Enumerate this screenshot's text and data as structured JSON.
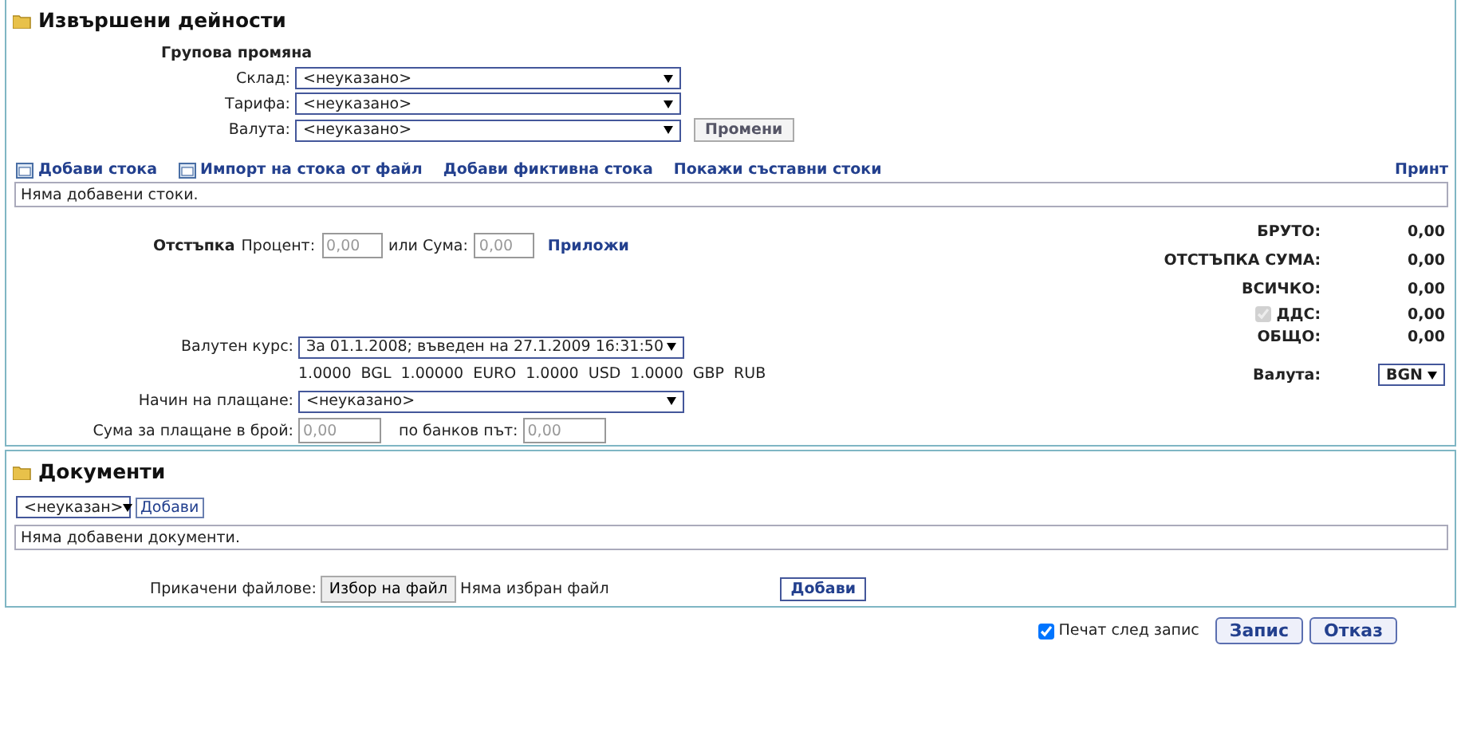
{
  "activities": {
    "title": "Извършени дейности",
    "group_change": {
      "title": "Групова промяна",
      "fields": [
        {
          "label": "Склад:",
          "value": "<неуказано>"
        },
        {
          "label": "Тарифа:",
          "value": "<неуказано>"
        },
        {
          "label": "Валута:",
          "value": "<неуказано>"
        }
      ],
      "apply_button": "Промени"
    },
    "links": [
      {
        "label": "Добави стока",
        "kind": "icon"
      },
      {
        "label": "Импорт на стока от файл",
        "kind": "icon"
      },
      {
        "label": "Добави фиктивна стока",
        "kind": "plain"
      },
      {
        "label": "Покажи съставни стоки",
        "kind": "plain"
      }
    ],
    "print_link": "Принт",
    "items_empty": "Няма добавени стоки.",
    "discount": {
      "title": "Отстъпка",
      "percent_label": "Процент:",
      "percent_placeholder": "0,00",
      "sum_label": "или Сума:",
      "sum_placeholder": "0,00",
      "apply_link": "Приложи"
    },
    "exchange": {
      "label": "Валутен курс:",
      "value": "За 01.1.2008; въведен на 27.1.2009 16:31:50",
      "rates": [
        "1.0000",
        "BGL",
        "1.00000",
        "EURO",
        "1.0000",
        "USD",
        "1.0000",
        "GBP",
        "RUB"
      ]
    },
    "payment": {
      "label": "Начин на плащане:",
      "value": "<неуказано>"
    },
    "cash": {
      "label": "Сума за плащане в брой:",
      "placeholder": "0,00"
    },
    "bank": {
      "label": "по банков път:",
      "placeholder": "0,00"
    },
    "totals": [
      {
        "label": "БРУТО:",
        "value": "0,00",
        "kind": "plain"
      },
      {
        "label": "ОТСТЪПКА СУМА:",
        "value": "0,00",
        "kind": "plain"
      },
      {
        "label": "ВСИЧКО:",
        "value": "0,00",
        "kind": "plain"
      },
      {
        "label": "ДДС:",
        "value": "0,00",
        "kind": "checkbox",
        "checked": true,
        "disabled": true
      },
      {
        "label": "ОБЩО:",
        "value": "0,00",
        "kind": "plain"
      }
    ],
    "currency": {
      "label": "Валута:",
      "value": "BGN"
    }
  },
  "documents": {
    "title": "Документи",
    "type_select": "<неуказан>",
    "add_button": "Добави",
    "empty": "Няма добавени документи.",
    "attach_label": "Прикачени файлове:",
    "file_button": "Избор на файл",
    "file_status": "Няма избран файл",
    "upload_button": "Добави"
  },
  "footer": {
    "print_after_save": {
      "label": "Печат след запис",
      "checked": true
    },
    "buttons": [
      "Запис",
      "Отказ"
    ]
  }
}
